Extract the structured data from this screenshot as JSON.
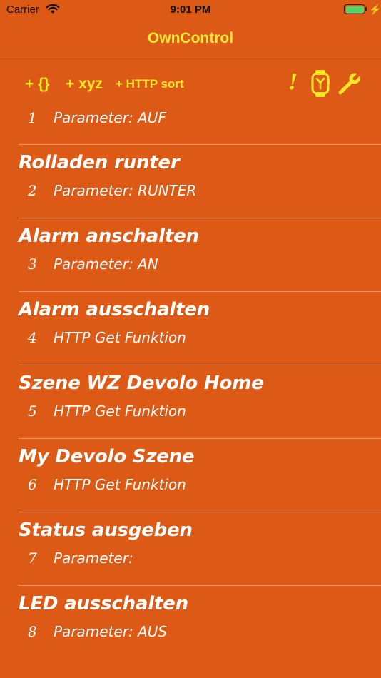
{
  "status_bar": {
    "carrier": "Carrier",
    "time": "9:01 PM",
    "battery_level": 1.0,
    "battery_color": "#4CD964"
  },
  "nav": {
    "title": "OwnControl"
  },
  "toolbar": {
    "add_json_label": "+ {}",
    "add_xyz_label": "+ xyz",
    "add_http_sort_label": "+ HTTP sort",
    "alert_label": "!",
    "watch_icon": "apple-watch-icon",
    "settings_icon": "wrench-icon"
  },
  "colors": {
    "background": "#DC5A15",
    "accent": "#FFE629",
    "text": "#FFFFFF"
  },
  "items": [
    {
      "title": "",
      "number": "1",
      "detail": "Parameter: AUF"
    },
    {
      "title": "Rolladen runter",
      "number": "2",
      "detail": "Parameter: RUNTER"
    },
    {
      "title": "Alarm anschalten",
      "number": "3",
      "detail": "Parameter: AN"
    },
    {
      "title": "Alarm ausschalten",
      "number": "4",
      "detail": "HTTP Get Funktion"
    },
    {
      "title": "Szene WZ Devolo Home",
      "number": "5",
      "detail": "HTTP Get Funktion"
    },
    {
      "title": "My Devolo Szene",
      "number": "6",
      "detail": "HTTP Get Funktion"
    },
    {
      "title": "Status ausgeben",
      "number": "7",
      "detail": "Parameter:"
    },
    {
      "title": "LED ausschalten",
      "number": "8",
      "detail": "Parameter: AUS"
    }
  ]
}
